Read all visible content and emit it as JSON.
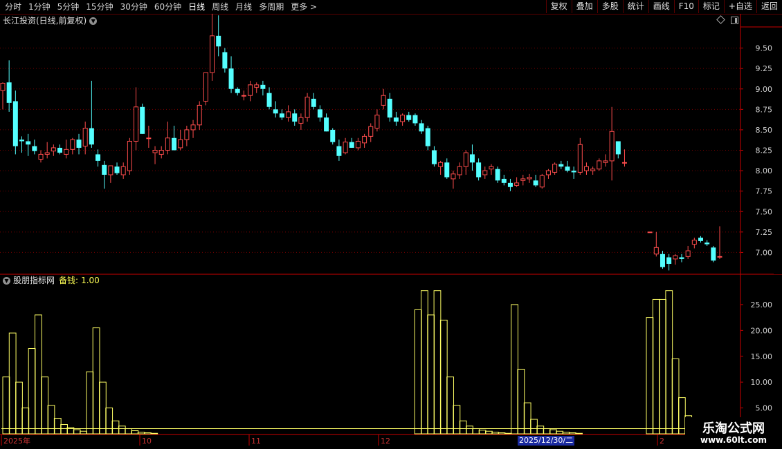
{
  "toolbar": {
    "periods": [
      "分时",
      "1分钟",
      "5分钟",
      "15分钟",
      "30分钟",
      "60分钟",
      "日线",
      "周线",
      "月线",
      "多周期",
      "更多 >"
    ],
    "active_period": "日线",
    "right_buttons": [
      "复权",
      "叠加",
      "多股",
      "统计",
      "画线",
      "F10",
      "标记",
      "+自选",
      "返回"
    ]
  },
  "main_title": "长江投资(日线,前复权)",
  "indicator": {
    "name": "股朋指标网",
    "param_label": "备钱:",
    "param_value": "1.00"
  },
  "colors": {
    "background": "#000000",
    "grid": "#7a0000",
    "up": "#ff4d4d",
    "down": "#54ffff",
    "indicator": "#ffff66",
    "axis": "#cc0000"
  },
  "icons": {
    "period_menu": "chevron-down-icon",
    "settings": "diamond-icon",
    "window": "window-icon",
    "indicator_menu": "chevron-down-icon"
  },
  "date_highlight": "2025/12/30/二",
  "watermark": {
    "line1": "乐淘公式网",
    "line2": "www.60lt.com"
  },
  "chart_data": [
    {
      "type": "candlestick",
      "title": "长江投资(日线,前复权)",
      "y_ticks": [
        "9.50",
        "9.25",
        "9.00",
        "8.75",
        "8.50",
        "8.25",
        "8.00",
        "7.75",
        "7.50",
        "7.25",
        "7.00"
      ],
      "ylim": [
        6.75,
        9.75
      ],
      "x_month_labels": [
        "2025年",
        "10",
        "11",
        "12",
        "2"
      ],
      "candles": [
        [
          8.98,
          9.08,
          8.75,
          9.07
        ],
        [
          9.08,
          9.35,
          8.72,
          8.83
        ],
        [
          8.85,
          8.98,
          8.2,
          8.3
        ],
        [
          8.38,
          8.42,
          8.22,
          8.36
        ],
        [
          8.36,
          8.45,
          8.18,
          8.32
        ],
        [
          8.3,
          8.38,
          8.2,
          8.24
        ],
        [
          8.14,
          8.25,
          8.1,
          8.2
        ],
        [
          8.2,
          8.35,
          8.15,
          8.22
        ],
        [
          8.24,
          8.32,
          8.18,
          8.28
        ],
        [
          8.28,
          8.32,
          8.2,
          8.22
        ],
        [
          8.2,
          8.38,
          8.15,
          8.26
        ],
        [
          8.26,
          8.4,
          8.2,
          8.38
        ],
        [
          8.38,
          8.45,
          8.2,
          8.28
        ],
        [
          8.3,
          8.6,
          8.2,
          8.52
        ],
        [
          8.52,
          9.1,
          8.28,
          8.32
        ],
        [
          8.2,
          8.26,
          8.05,
          8.12
        ],
        [
          8.07,
          8.12,
          7.78,
          7.95
        ],
        [
          7.95,
          8.05,
          7.85,
          8.06
        ],
        [
          8.05,
          8.1,
          7.95,
          7.97
        ],
        [
          7.95,
          8.1,
          7.9,
          8.05
        ],
        [
          8.0,
          8.4,
          7.95,
          8.36
        ],
        [
          8.36,
          9.02,
          8.25,
          8.78
        ],
        [
          8.78,
          8.82,
          8.45,
          8.45
        ],
        [
          8.4,
          8.55,
          8.28,
          8.4
        ],
        [
          8.22,
          8.3,
          8.08,
          8.25
        ],
        [
          8.2,
          8.3,
          8.15,
          8.25
        ],
        [
          8.25,
          8.6,
          8.2,
          8.4
        ],
        [
          8.4,
          8.55,
          8.3,
          8.25
        ],
        [
          8.28,
          8.5,
          8.25,
          8.38
        ],
        [
          8.38,
          8.55,
          8.3,
          8.5
        ],
        [
          8.5,
          8.62,
          8.4,
          8.56
        ],
        [
          8.56,
          8.85,
          8.5,
          8.8
        ],
        [
          8.85,
          9.15,
          8.8,
          9.2
        ],
        [
          9.2,
          9.92,
          9.1,
          9.65
        ],
        [
          9.65,
          9.9,
          9.4,
          9.52
        ],
        [
          9.45,
          9.5,
          9.2,
          9.25
        ],
        [
          9.25,
          9.4,
          8.95,
          9.0
        ],
        [
          9.0,
          9.02,
          8.92,
          8.95
        ],
        [
          8.92,
          8.98,
          8.86,
          8.92
        ],
        [
          8.92,
          9.1,
          8.85,
          9.05
        ],
        [
          9.02,
          9.08,
          8.95,
          9.05
        ],
        [
          9.05,
          9.1,
          8.92,
          9.0
        ],
        [
          8.95,
          9.02,
          8.75,
          8.78
        ],
        [
          8.75,
          8.85,
          8.65,
          8.7
        ],
        [
          8.7,
          8.75,
          8.62,
          8.65
        ],
        [
          8.65,
          8.8,
          8.6,
          8.72
        ],
        [
          8.7,
          8.75,
          8.55,
          8.6
        ],
        [
          8.58,
          8.7,
          8.5,
          8.65
        ],
        [
          8.65,
          8.95,
          8.6,
          8.9
        ],
        [
          8.88,
          8.95,
          8.75,
          8.78
        ],
        [
          8.75,
          8.8,
          8.6,
          8.65
        ],
        [
          8.65,
          8.7,
          8.48,
          8.48
        ],
        [
          8.5,
          8.52,
          8.32,
          8.35
        ],
        [
          8.3,
          8.38,
          8.12,
          8.18
        ],
        [
          8.22,
          8.4,
          8.2,
          8.35
        ],
        [
          8.35,
          8.4,
          8.28,
          8.28
        ],
        [
          8.28,
          8.4,
          8.25,
          8.36
        ],
        [
          8.34,
          8.45,
          8.28,
          8.42
        ],
        [
          8.42,
          8.58,
          8.35,
          8.54
        ],
        [
          8.52,
          8.75,
          8.48,
          8.68
        ],
        [
          8.8,
          9.0,
          8.75,
          8.92
        ],
        [
          8.88,
          8.95,
          8.6,
          8.65
        ],
        [
          8.65,
          8.72,
          8.55,
          8.6
        ],
        [
          8.6,
          8.7,
          8.55,
          8.68
        ],
        [
          8.68,
          8.72,
          8.6,
          8.62
        ],
        [
          8.68,
          8.7,
          8.55,
          8.58
        ],
        [
          8.58,
          8.62,
          8.45,
          8.48
        ],
        [
          8.52,
          8.55,
          8.25,
          8.3
        ],
        [
          8.25,
          8.3,
          8.05,
          8.08
        ],
        [
          8.05,
          8.12,
          7.95,
          8.1
        ],
        [
          8.1,
          8.15,
          7.9,
          7.92
        ],
        [
          7.9,
          8.0,
          7.78,
          7.96
        ],
        [
          7.95,
          8.1,
          7.9,
          8.05
        ],
        [
          8.05,
          8.25,
          7.95,
          8.22
        ],
        [
          8.2,
          8.32,
          8.0,
          8.1
        ],
        [
          8.1,
          8.15,
          7.88,
          7.92
        ],
        [
          7.95,
          8.05,
          7.9,
          8.0
        ],
        [
          8.02,
          8.08,
          7.95,
          8.05
        ],
        [
          8.02,
          8.05,
          7.85,
          7.88
        ],
        [
          7.9,
          7.95,
          7.82,
          7.85
        ],
        [
          7.85,
          7.9,
          7.75,
          7.8
        ],
        [
          7.82,
          7.92,
          7.8,
          7.85
        ],
        [
          7.88,
          7.95,
          7.82,
          7.9
        ],
        [
          7.9,
          7.96,
          7.85,
          7.92
        ],
        [
          7.88,
          7.95,
          7.8,
          7.82
        ],
        [
          7.8,
          7.96,
          7.78,
          7.94
        ],
        [
          7.95,
          8.02,
          7.9,
          8.0
        ],
        [
          7.98,
          8.1,
          7.95,
          8.08
        ],
        [
          8.08,
          8.12,
          8.02,
          8.05
        ],
        [
          8.05,
          8.12,
          7.98,
          8.0
        ],
        [
          8.0,
          8.05,
          7.9,
          7.98
        ],
        [
          7.98,
          8.4,
          7.95,
          8.32
        ],
        [
          8.0,
          8.1,
          7.95,
          8.05
        ],
        [
          8.0,
          8.05,
          7.95,
          8.02
        ],
        [
          8.02,
          8.15,
          8.0,
          8.12
        ],
        [
          8.1,
          8.2,
          8.05,
          8.12
        ],
        [
          8.12,
          8.78,
          7.88,
          8.48
        ],
        [
          8.36,
          8.36,
          8.15,
          8.2
        ],
        [
          8.1,
          8.26,
          8.05,
          8.1
        ],
        null,
        null,
        null,
        [
          7.25,
          7.25,
          7.25,
          7.25
        ],
        [
          6.98,
          7.25,
          6.95,
          7.06
        ],
        [
          6.98,
          7.02,
          6.8,
          6.82
        ],
        [
          6.94,
          6.98,
          6.78,
          6.86
        ],
        [
          6.92,
          6.98,
          6.85,
          6.96
        ],
        [
          6.94,
          6.98,
          6.88,
          6.92
        ],
        [
          6.95,
          7.08,
          6.92,
          7.02
        ],
        [
          7.1,
          7.18,
          7.05,
          7.15
        ],
        [
          7.18,
          7.2,
          7.12,
          7.14
        ],
        [
          7.12,
          7.15,
          7.08,
          7.1
        ],
        [
          7.06,
          7.08,
          6.88,
          6.9
        ],
        [
          6.95,
          7.32,
          6.92,
          6.95
        ]
      ]
    },
    {
      "type": "bar",
      "title": "股朋指标网",
      "y_ticks": [
        "25.00",
        "20.00",
        "15.00",
        "10.00",
        "5.00"
      ],
      "ylim": [
        0,
        29
      ],
      "baseline": 1.0,
      "values": [
        11,
        19.5,
        10,
        5,
        16.5,
        23,
        11,
        5.5,
        3,
        1.8,
        1.2,
        0.8,
        0.5,
        12,
        20.5,
        10,
        5,
        2.5,
        1.5,
        1,
        0.6,
        0.3,
        0.2,
        0.1,
        0,
        0,
        0,
        0,
        0,
        0,
        0,
        0,
        0,
        0,
        0,
        0,
        0,
        0,
        0,
        0,
        0,
        0,
        0,
        0,
        0,
        0,
        0,
        0,
        0,
        0,
        0,
        0,
        0,
        0,
        0,
        0,
        0,
        0,
        0,
        0,
        0,
        0,
        0,
        0,
        24,
        27.7,
        23,
        27.7,
        22,
        11,
        5.5,
        2.5,
        1.5,
        1,
        0.7,
        0.5,
        0.3,
        0.2,
        0.1,
        25,
        12.5,
        6,
        2.8,
        1.5,
        1,
        0.8,
        0.5,
        0.3,
        0.2,
        0.1,
        0,
        0,
        0,
        0,
        0,
        0,
        0,
        0,
        0,
        0,
        22.5,
        26,
        26,
        27.7,
        14.5,
        7,
        3.5
      ]
    }
  ]
}
